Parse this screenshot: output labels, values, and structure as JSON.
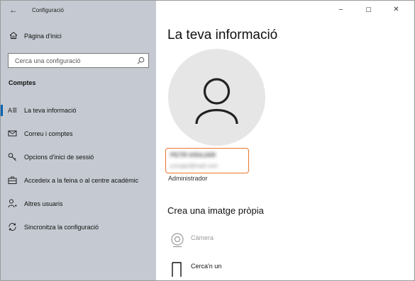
{
  "window": {
    "title": "Configuració",
    "controls": {
      "minimize": "–",
      "maximize": "☐",
      "close": "✕"
    }
  },
  "sidebar": {
    "back_icon": "←",
    "home_label": "Pàgina d'inici",
    "search_placeholder": "Cerca una configuració",
    "section_title": "Comptes",
    "items": [
      {
        "label": "La teva informació",
        "icon": "person-card-icon",
        "active": true
      },
      {
        "label": "Correu i comptes",
        "icon": "mail-icon",
        "active": false
      },
      {
        "label": "Opcions d'inici de sessió",
        "icon": "key-icon",
        "active": false
      },
      {
        "label": "Accedeix a la feina o al centre acadèmic",
        "icon": "briefcase-icon",
        "active": false
      },
      {
        "label": "Altres usuaris",
        "icon": "person-add-icon",
        "active": false
      },
      {
        "label": "Sincronitza la configuració",
        "icon": "sync-icon",
        "active": false
      }
    ]
  },
  "main": {
    "title": "La teva informació",
    "user": {
      "name": "PETR KRAJAR",
      "email": "p.krajar@mail.com",
      "role": "Administrador"
    },
    "create_picture_title": "Crea una imatge pròpia",
    "options": [
      {
        "label": "Càmera",
        "icon": "camera-icon",
        "enabled": false
      },
      {
        "label": "Cerca'n un",
        "icon": "browse-file-icon",
        "enabled": true
      }
    ]
  },
  "colors": {
    "sidebar_bg": "#c5cad2",
    "accent": "#0063b1",
    "highlight_border": "#e8762d",
    "avatar_bg": "#e6e6e6"
  }
}
